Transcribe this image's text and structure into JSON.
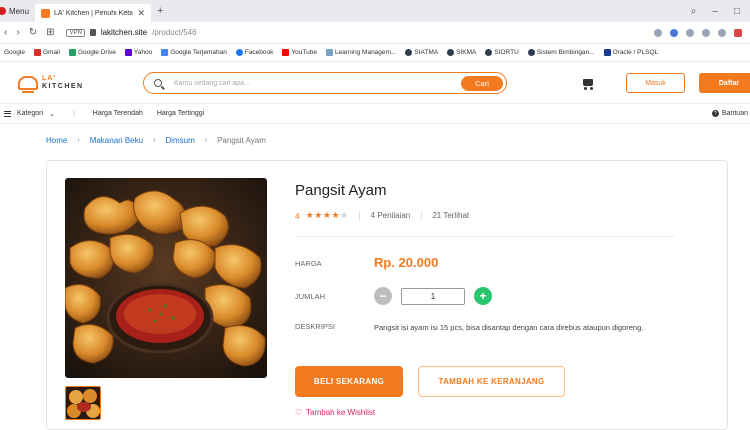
{
  "browser": {
    "menu_label": "Menu",
    "tab_title": "LA' Kitchen | Penuhi Kebut",
    "url_host": "lakitchen.site",
    "url_path": "/product/546",
    "vpn_badge": "VPN",
    "bookmarks": [
      "Google",
      "Gmail",
      "Google Drive",
      "Yahoo",
      "Google Terjemahan",
      "Facebook",
      "YouTube",
      "Learning Managem...",
      "SIATMA",
      "SIKMA",
      "SIORTU",
      "Sistem Bimbingan...",
      "Oracle / PLSQL"
    ]
  },
  "site": {
    "logo_line1": "LA'",
    "logo_line2": "KITCHEN",
    "search_placeholder": "Kamu sedang cari apa...",
    "search_button": "Cari",
    "login_button": "Masuk",
    "register_button": "Daftar",
    "category_label": "Kategori",
    "nav_low_price": "Harga Terendah",
    "nav_high_price": "Harga Tertinggi",
    "help_label": "Bantuan"
  },
  "breadcrumb": [
    "Home",
    "Makanan Beku",
    "Dimsum",
    "Pangsit Ayam"
  ],
  "product": {
    "name": "Pangsit Ayam",
    "rating": "4",
    "rating_stars": 4,
    "reviews": "4 Penilaian",
    "views": "21 Terlihat",
    "price_label": "HARGA",
    "price": "Rp. 20.000",
    "qty_label": "JUMLAH",
    "qty_value": "1",
    "desc_label": "DESKRIPSI",
    "description": "Pangsit isi ayam isi 15 pcs, bisa disantap dengan cara direbus ataupun digoreng.",
    "buy_button": "BELI SEKARANG",
    "cart_button": "TAMBAH KE KERANJANG",
    "wishlist": "Tambah ke Wishlist"
  },
  "colors": {
    "accent": "#f47a20",
    "link": "#1a6fd1",
    "plus": "#2cc56f",
    "wishlist": "#e0245e"
  }
}
